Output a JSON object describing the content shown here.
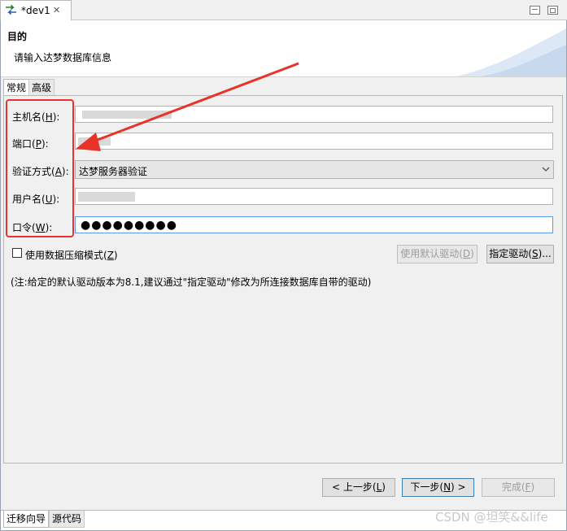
{
  "editor_tab": {
    "title": "*dev1",
    "close": "✕"
  },
  "header": {
    "title": "目的",
    "description": "请输入达梦数据库信息"
  },
  "inner_tabs": [
    {
      "label": "常规",
      "active": true
    },
    {
      "label": "高级",
      "active": false
    }
  ],
  "form": {
    "host": {
      "label": "主机名(",
      "mnemonic": "H",
      "suffix": "):"
    },
    "port": {
      "label": "端口(",
      "mnemonic": "P",
      "suffix": "):"
    },
    "auth": {
      "label": "验证方式(",
      "mnemonic": "A",
      "suffix": "):",
      "value": "达梦服务器验证"
    },
    "user": {
      "label": "用户名(",
      "mnemonic": "U",
      "suffix": "):"
    },
    "password": {
      "label": "口令(",
      "mnemonic": "W",
      "suffix": "):",
      "value": "●●●●●●●●●"
    }
  },
  "compression": {
    "label": "使用数据压缩模式(",
    "mnemonic": "Z",
    "suffix": ")",
    "checked": false
  },
  "driver_buttons": {
    "default": {
      "label": "使用默认驱动(",
      "mnemonic": "D",
      "suffix": ")"
    },
    "specify": {
      "label": "指定驱动(",
      "mnemonic": "S",
      "suffix": ")..."
    }
  },
  "note": "(注:给定的默认驱动版本为8.1,建议通过\"指定驱动\"修改为所连接数据库自带的驱动)",
  "nav_buttons": {
    "back": {
      "label": "< 上一步(",
      "mnemonic": "L",
      "suffix": ")"
    },
    "next": {
      "label": "下一步(",
      "mnemonic": "N",
      "suffix": ") >"
    },
    "finish": {
      "label": "完成(",
      "mnemonic": "F",
      "suffix": ")"
    }
  },
  "bottom_tabs": [
    {
      "label": "迁移向导",
      "active": true
    },
    {
      "label": "源代码",
      "active": false
    }
  ],
  "watermark": "CSDN @坦笑&&life",
  "colors": {
    "annotation_red": "#e8332a",
    "focus_blue": "#569de5",
    "panel_bg": "#f0f0f0"
  }
}
